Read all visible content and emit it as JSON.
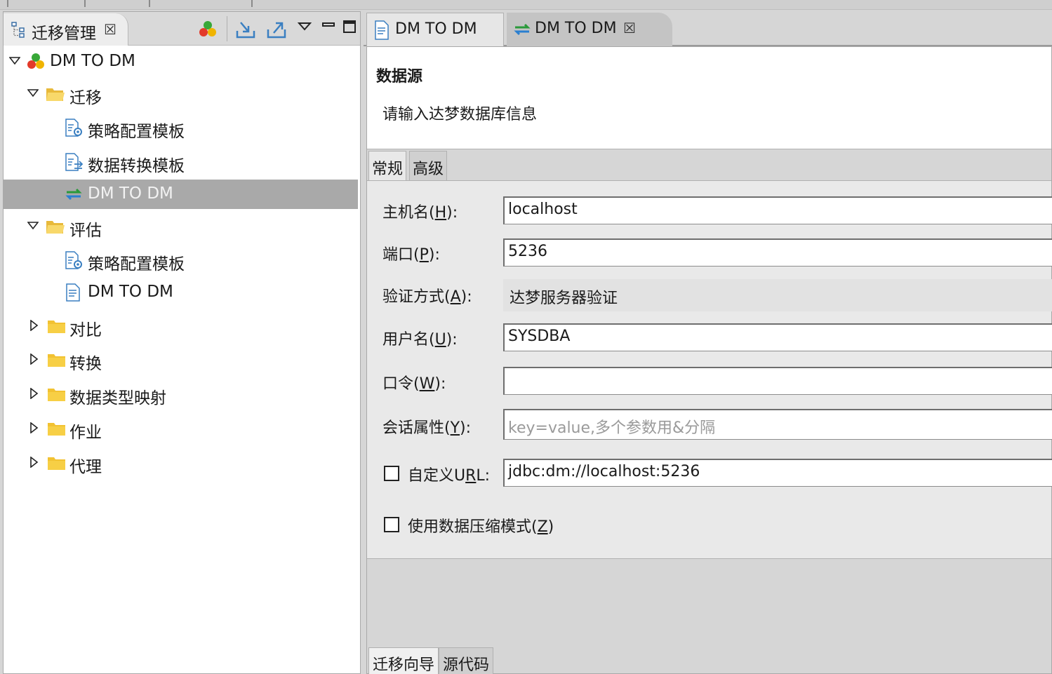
{
  "left_view": {
    "tab_label": "迁移管理",
    "tab_close": "☒",
    "toolbar": [
      "colored-balls-icon",
      "import-icon",
      "export-icon",
      "view-menu-icon",
      "minimize-icon",
      "maximize-icon"
    ]
  },
  "tree": [
    {
      "label": "DM TO DM",
      "icon": "project-icon",
      "twisty": "expanded",
      "level": 0
    },
    {
      "label": "迁移",
      "icon": "folder-open-icon",
      "twisty": "expanded",
      "level": 1
    },
    {
      "label": "策略配置模板",
      "icon": "strategy-template-icon",
      "twisty": "none",
      "level": 2
    },
    {
      "label": "数据转换模板",
      "icon": "convert-template-icon",
      "twisty": "none",
      "level": 2
    },
    {
      "label": "DM TO DM",
      "icon": "migration-icon",
      "twisty": "none",
      "level": 2,
      "selected": true
    },
    {
      "label": "评估",
      "icon": "folder-open-icon",
      "twisty": "expanded",
      "level": 1
    },
    {
      "label": "策略配置模板",
      "icon": "strategy-template-icon",
      "twisty": "none",
      "level": 2
    },
    {
      "label": "DM TO DM",
      "icon": "document-icon",
      "twisty": "none",
      "level": 2
    },
    {
      "label": "对比",
      "icon": "folder-icon",
      "twisty": "collapsed",
      "level": 1
    },
    {
      "label": "转换",
      "icon": "folder-icon",
      "twisty": "collapsed",
      "level": 1
    },
    {
      "label": "数据类型映射",
      "icon": "folder-icon",
      "twisty": "collapsed",
      "level": 1
    },
    {
      "label": "作业",
      "icon": "folder-icon",
      "twisty": "collapsed",
      "level": 1
    },
    {
      "label": "代理",
      "icon": "folder-icon",
      "twisty": "collapsed",
      "level": 1
    }
  ],
  "editor": {
    "tabs": [
      {
        "label": "DM TO DM",
        "icon": "document-icon"
      },
      {
        "label": "DM TO DM",
        "icon": "migration-icon",
        "close": "☒",
        "active": true
      }
    ],
    "header_title": "数据源",
    "header_desc": "请输入达梦数据库信息",
    "subtabs": [
      "常规",
      "高级"
    ],
    "form": {
      "host": {
        "label": "主机名(",
        "mn": "H",
        "end": "):",
        "value": "localhost"
      },
      "port": {
        "label": "端口(",
        "mn": "P",
        "end": "):",
        "value": "5236"
      },
      "auth": {
        "label": "验证方式(",
        "mn": "A",
        "end": "):",
        "value": "达梦服务器验证"
      },
      "user": {
        "label": "用户名(",
        "mn": "U",
        "end": "):",
        "value": "SYSDBA"
      },
      "password": {
        "label": "口令(",
        "mn": "W",
        "end": "):",
        "value": ""
      },
      "session": {
        "label": "会话属性(",
        "mn": "Y",
        "end": "):",
        "placeholder": "key=value,多个参数用&分隔"
      },
      "custom_url": {
        "label_pre": "自定义U",
        "mn": "R",
        "label_post": "L:",
        "value": "jdbc:dm://localhost:5236",
        "checked": false
      },
      "compress": {
        "label_pre": "使用数据压缩模式(",
        "mn": "Z",
        "label_post": ")",
        "checked": false
      }
    },
    "bottom_tabs": [
      "迁移向导",
      "源代码"
    ]
  }
}
